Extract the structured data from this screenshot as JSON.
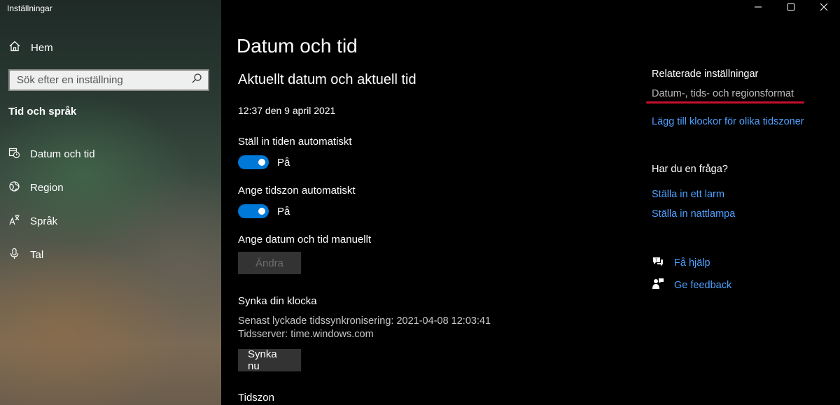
{
  "window": {
    "title": "Inställningar"
  },
  "sidebar": {
    "home_label": "Hem",
    "search_placeholder": "Sök efter en inställning",
    "section_heading": "Tid och språk",
    "items": [
      {
        "label": "Datum och tid",
        "icon": "calendar-clock-icon"
      },
      {
        "label": "Region",
        "icon": "globe-icon"
      },
      {
        "label": "Språk",
        "icon": "language-icon"
      },
      {
        "label": "Tal",
        "icon": "microphone-icon"
      }
    ]
  },
  "main": {
    "page_title": "Datum och tid",
    "section_title": "Aktuellt datum och aktuell tid",
    "current_datetime": "12:37 den 9 april 2021",
    "auto_time": {
      "label": "Ställ in tiden automatiskt",
      "state": "På"
    },
    "auto_timezone": {
      "label": "Ange tidszon automatiskt",
      "state": "På"
    },
    "manual": {
      "label": "Ange datum och tid manuellt",
      "button": "Ändra"
    },
    "sync": {
      "heading": "Synka din klocka",
      "last_sync": "Senast lyckade tidssynkronisering: 2021-04-08 12:03:41",
      "server": "Tidsserver: time.windows.com",
      "button": "Synka nu"
    },
    "timezone_heading": "Tidszon"
  },
  "related": {
    "heading": "Relaterade inställningar",
    "format_link": "Datum-, tids- och regionsformat",
    "clocks_link": "Lägg till klockor för olika tidszoner"
  },
  "question": {
    "heading": "Har du en fråga?",
    "links": [
      "Ställa in ett larm",
      "Ställa in nattlampa"
    ]
  },
  "help": {
    "get_help": "Få hjälp",
    "feedback": "Ge feedback"
  },
  "colors": {
    "accent": "#0078d7",
    "link": "#4ea1ff",
    "highlight": "#c8102e"
  }
}
